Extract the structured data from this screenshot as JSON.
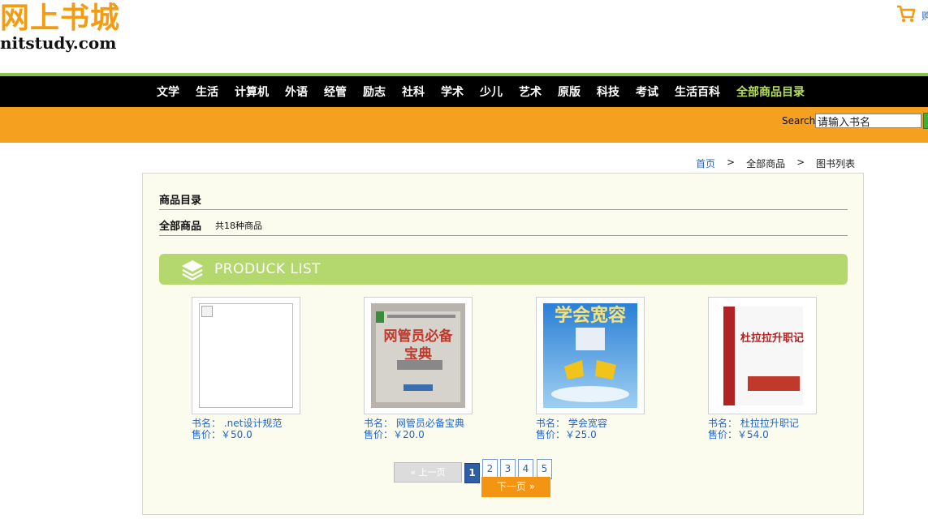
{
  "logo": {
    "title": "网上书城",
    "domain": "nitstudy.com"
  },
  "cart": {
    "label": "购"
  },
  "nav": {
    "items": [
      "文学",
      "生活",
      "计算机",
      "外语",
      "经管",
      "励志",
      "社科",
      "学术",
      "少儿",
      "艺术",
      "原版",
      "科技",
      "考试",
      "生活百科"
    ],
    "highlight": "全部商品目录"
  },
  "search": {
    "label": "Search",
    "value": "请输入书名"
  },
  "breadcrumb": {
    "home": "首页",
    "sep": ">",
    "all": "全部商品",
    "current": "图书列表"
  },
  "catalog": {
    "title": "商品目录",
    "all_label": "全部商品",
    "count": "共18种商品"
  },
  "product_list": {
    "label": "PRODUCK LIST"
  },
  "products": [
    {
      "name": "书名： .net设计规范",
      "price": "售价：￥50.0",
      "cover_text": ""
    },
    {
      "name": "书名： 网管员必备宝典",
      "price": "售价：￥20.0",
      "cover_text": "网管员必备宝典"
    },
    {
      "name": "书名： 学会宽容",
      "price": "售价：￥25.0",
      "cover_text": "学会宽容"
    },
    {
      "name": "书名： 杜拉拉升职记",
      "price": "售价：￥54.0",
      "cover_text": "杜拉拉升职记"
    }
  ],
  "pagination": {
    "prev": "上一页",
    "next": "下一页",
    "pages": [
      "1",
      "2",
      "3",
      "4",
      "5"
    ],
    "current": "1"
  },
  "colors": {
    "orange": "#f5a01e",
    "green": "#b5d86e",
    "link": "#2266cc",
    "nav_bg": "#000000"
  }
}
